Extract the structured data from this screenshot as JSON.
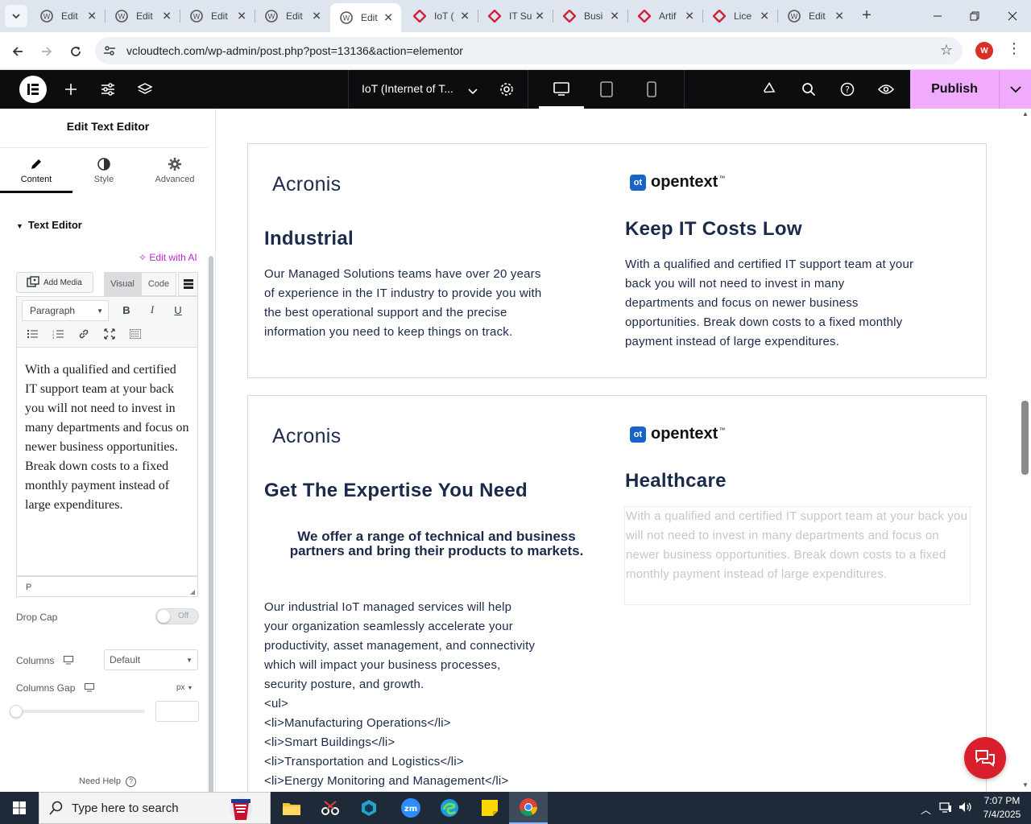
{
  "browser": {
    "tabs": [
      {
        "title": "Edit",
        "icon": "wordpress-icon",
        "active": false
      },
      {
        "title": "Edit",
        "icon": "wordpress-icon",
        "active": false
      },
      {
        "title": "Edit",
        "icon": "wordpress-icon",
        "active": false
      },
      {
        "title": "Edit",
        "icon": "wordpress-icon",
        "active": false
      },
      {
        "title": "Edit",
        "icon": "wordpress-icon",
        "active": true
      },
      {
        "title": "IoT (",
        "icon": "red-diamond-icon",
        "active": false
      },
      {
        "title": "IT Su",
        "icon": "red-diamond-icon",
        "active": false
      },
      {
        "title": "Busi",
        "icon": "red-diamond-icon",
        "active": false
      },
      {
        "title": "Artif",
        "icon": "red-diamond-icon",
        "active": false
      },
      {
        "title": "Lice",
        "icon": "red-diamond-icon",
        "active": false
      },
      {
        "title": "Edit",
        "icon": "wordpress-icon",
        "active": false
      }
    ],
    "url": "vcloudtech.com/wp-admin/post.php?post=13136&action=elementor",
    "profile_initial": "W"
  },
  "elementor": {
    "document_title": "IoT (Internet of T...",
    "publish_label": "Publish"
  },
  "panel": {
    "title": "Edit Text Editor",
    "tabs": [
      {
        "label": "Content",
        "icon": "pencil-icon"
      },
      {
        "label": "Style",
        "icon": "half-circle-icon"
      },
      {
        "label": "Advanced",
        "icon": "gear-icon"
      }
    ],
    "section_title": "Text Editor",
    "edit_with_ai": "Edit with AI",
    "add_media": "Add Media",
    "visual_tab": "Visual",
    "code_tab": "Code",
    "paragraph_format": "Paragraph",
    "editor_text": "With a qualified and certified IT support team at your back you will not need to invest in many departments and focus on newer business opportunities. Break down costs to a fixed monthly payment instead of large expenditures.",
    "status_path": "P",
    "drop_cap_label": "Drop Cap",
    "drop_cap_state": "Off",
    "columns_label": "Columns",
    "columns_value": "Default",
    "columns_gap_label": "Columns Gap",
    "columns_gap_unit": "px",
    "need_help": "Need Help"
  },
  "canvas": {
    "card1": {
      "left_logo": "Acronis",
      "left_heading": "Industrial",
      "left_text": "Our Managed Solutions teams have over 20 years of experience in the IT industry to provide you with the best operational support and the precise information you need to keep things on track.",
      "right_logo": "opentext",
      "right_heading": "Keep IT Costs Low",
      "right_text": "With a qualified and certified IT support team at your back you will not need to invest in many departments and focus on newer business opportunities. Break down costs to a fixed monthly payment instead of large expenditures."
    },
    "card2": {
      "left_logo": "Acronis",
      "left_heading": "Get The Expertise You Need",
      "offer_line1": "We offer a range of technical and business",
      "offer_line2": "partners and bring their products to markets.",
      "left_text": "Our industrial IoT managed services will help your organization seamlessly accelerate your productivity, asset management, and connectivity which will impact your business processes, security posture, and growth.",
      "code_lines": [
        "<ul>",
        "<li>Manufacturing Operations</li>",
        "<li>Smart Buildings</li>",
        "<li>Transportation and Logistics</li>",
        "<li>Energy Monitoring and Management</li>"
      ],
      "right_logo": "opentext",
      "right_heading": "Healthcare",
      "right_text": "With a qualified and certified IT support team at your back you will not need to invest in many departments and focus on newer business opportunities. Break down costs to a fixed monthly payment instead of large expenditures."
    }
  },
  "taskbar": {
    "search_placeholder": "Type here to search",
    "time": "7:07 PM",
    "date": "7/4/2025"
  },
  "colors": {
    "publish": "#f0abfc",
    "heading": "#1b2a4a",
    "chat_fab": "#d91f2c",
    "ai_link": "#c026d3"
  }
}
